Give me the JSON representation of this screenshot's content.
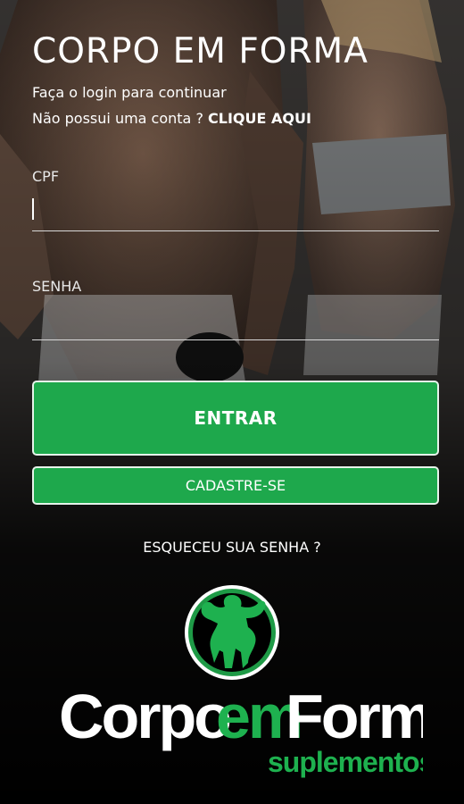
{
  "header": {
    "title": "CORPO EM FORMA",
    "subtitle": "Faça o login para continuar",
    "signup_prompt": "Não possui uma conta ? ",
    "signup_link": "CLIQUE AQUI"
  },
  "form": {
    "cpf_label": "CPF",
    "cpf_value": "",
    "password_label": "SENHA",
    "password_value": ""
  },
  "actions": {
    "login_label": "ENTRAR",
    "register_label": "CADASTRE-SE",
    "forgot_label": "ESQUECEU SUA SENHA ?"
  },
  "logo": {
    "word_corpo": "Corpo",
    "word_em": "em",
    "word_forma": "Forma",
    "tagline": "suplementos"
  },
  "colors": {
    "brand_green": "#1ea84c",
    "text_white": "#ffffff",
    "background": "#000000"
  }
}
